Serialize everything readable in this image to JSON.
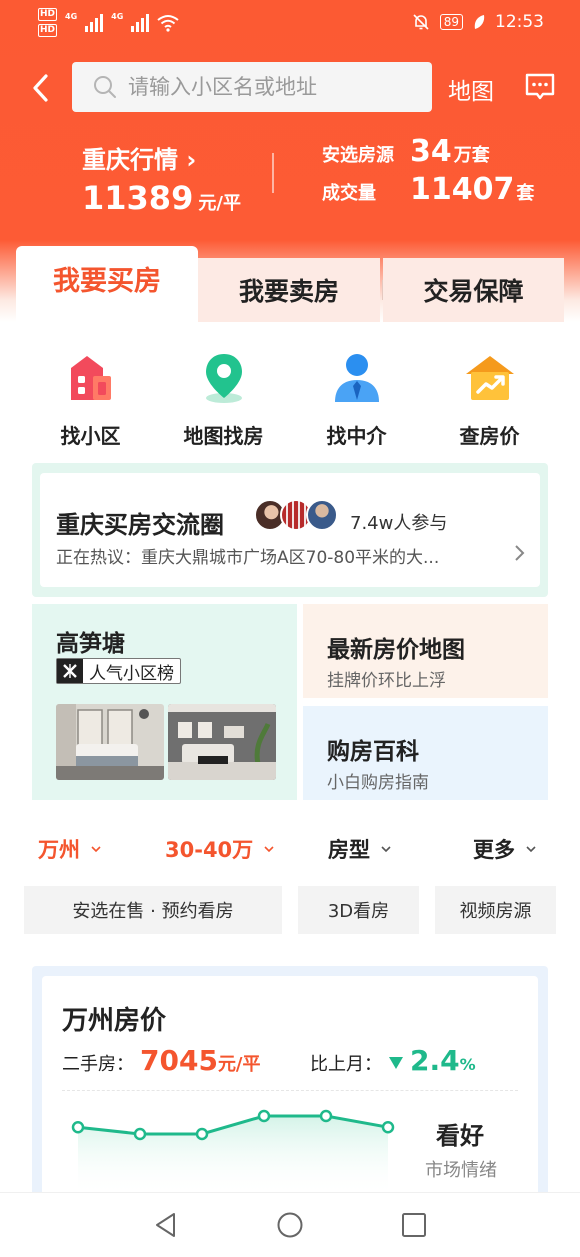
{
  "status_bar": {
    "hd1": "HD",
    "hd2": "HD",
    "net1": "4G",
    "net2": "4G",
    "battery": "89",
    "time": "12:53"
  },
  "header": {
    "search_placeholder": "请输入小区名或地址",
    "map_label": "地图",
    "market_title": "重庆行情 ›",
    "market_price": "11389",
    "market_price_unit": "元/平",
    "selected_label": "安选房源",
    "selected_value": "34",
    "selected_unit": "万套",
    "deal_label": "成交量",
    "deal_value": "11407",
    "deal_unit": "套"
  },
  "tabs": [
    {
      "label": "我要买房",
      "active": true
    },
    {
      "label": "我要卖房",
      "active": false
    },
    {
      "label": "交易保障",
      "active": false
    }
  ],
  "quick_nav": [
    {
      "label": "找小区",
      "icon": "building-icon"
    },
    {
      "label": "地图找房",
      "icon": "map-pin-icon"
    },
    {
      "label": "找中介",
      "icon": "agent-icon"
    },
    {
      "label": "查房价",
      "icon": "house-price-icon"
    }
  ],
  "circle": {
    "title": "重庆买房交流圈",
    "participants": "7.4w人参与",
    "subtitle": "正在热议：重庆大鼎城市广场A区70-80平米的大..."
  },
  "ranking": {
    "title": "高笋塘",
    "badge": "人气小区榜"
  },
  "price_map": {
    "title": "最新房价地图",
    "subtitle": "挂牌价环比上浮"
  },
  "wiki": {
    "title": "购房百科",
    "subtitle": "小白购房指南"
  },
  "filters": [
    {
      "label": "万州",
      "active": true
    },
    {
      "label": "30-40万",
      "active": true
    },
    {
      "label": "房型",
      "active": false
    },
    {
      "label": "更多",
      "active": false
    }
  ],
  "tags": [
    "安选在售 · 预约看房",
    "3D看房",
    "视频房源"
  ],
  "price_card": {
    "title": "万州房价",
    "second_hand_label": "二手房：",
    "price": "7045",
    "price_unit": "元/平",
    "mom_label": "比上月：",
    "mom_value": "2.4",
    "mom_unit": "%",
    "mom_direction": "down",
    "mood_title": "看好",
    "mood_sub": "市场情绪",
    "trend_levels": [
      0.55,
      0.28,
      0.28,
      1.0,
      1.0,
      0.55
    ]
  },
  "colors": {
    "brand": "#fc5a33",
    "accent": "#f4552e",
    "green": "#1fb98b"
  }
}
